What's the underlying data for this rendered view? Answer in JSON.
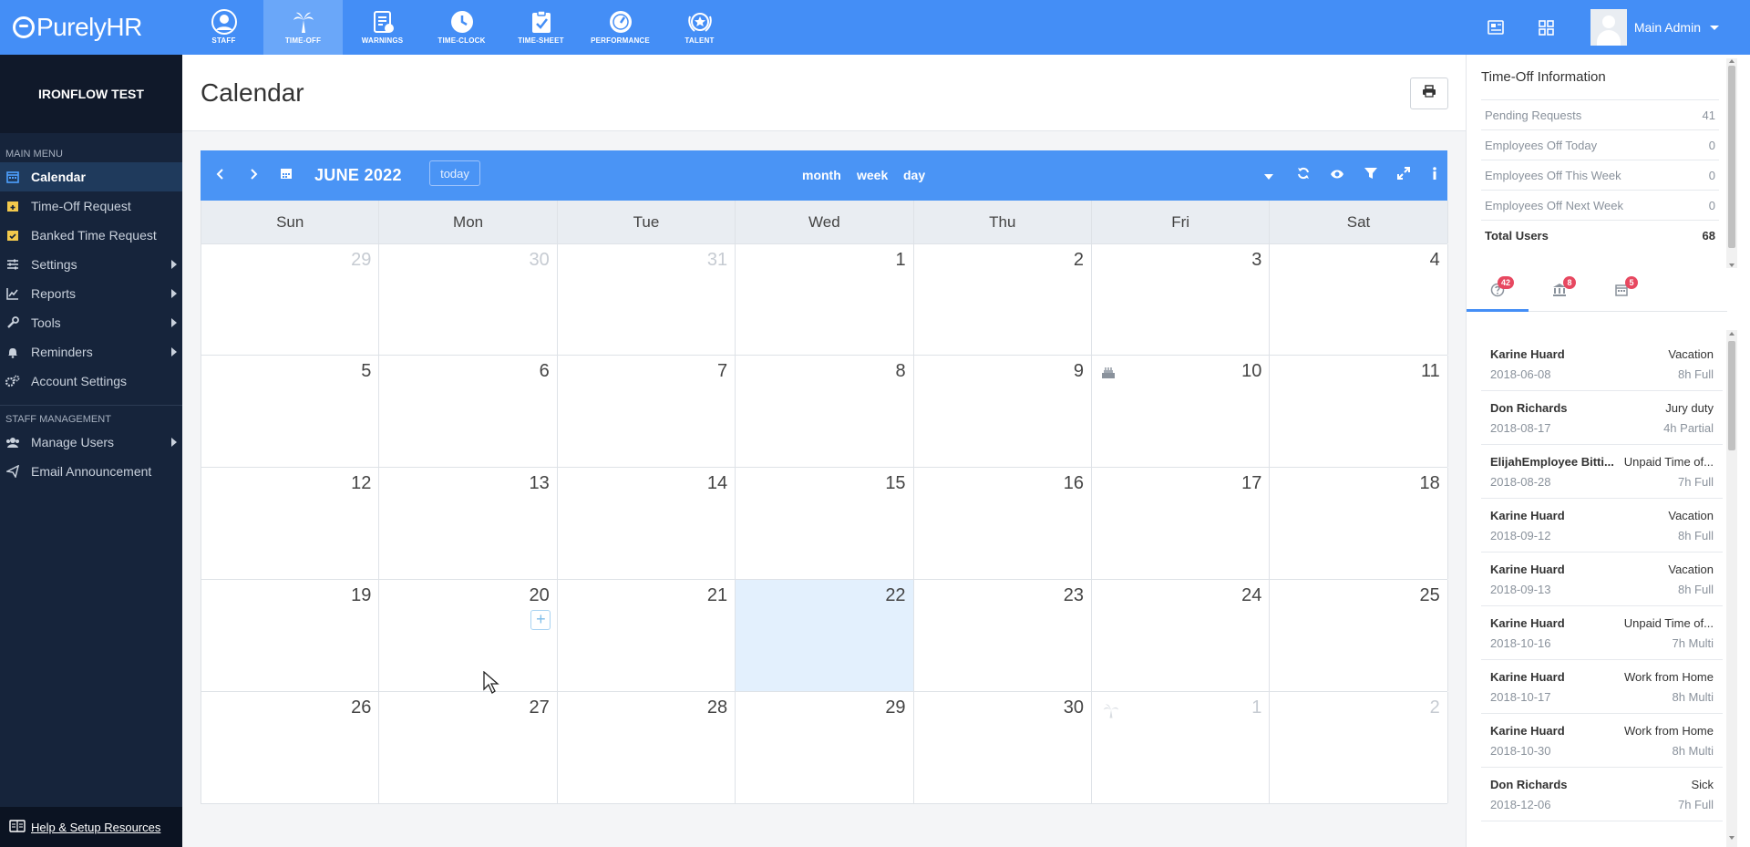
{
  "app": {
    "logo_text": "PurelyHR"
  },
  "modules": [
    {
      "label": "STAFF",
      "icon": "staff-icon"
    },
    {
      "label": "TIME-OFF",
      "icon": "palm-tree-icon",
      "active": true
    },
    {
      "label": "WARNINGS",
      "icon": "warning-doc-icon"
    },
    {
      "label": "TIME-CLOCK",
      "icon": "clock-icon"
    },
    {
      "label": "TIME-SHEET",
      "icon": "timesheet-icon"
    },
    {
      "label": "PERFORMANCE",
      "icon": "gauge-icon"
    },
    {
      "label": "TALENT",
      "icon": "award-star-icon"
    }
  ],
  "user": {
    "name": "Main Admin"
  },
  "sidebar": {
    "org_name": "IRONFLOW TEST",
    "main_menu_label": "MAIN MENU",
    "items": [
      {
        "label": "Calendar",
        "icon": "calendar-icon",
        "active": true
      },
      {
        "label": "Time-Off Request",
        "icon": "calendar-plus-icon"
      },
      {
        "label": "Banked Time Request",
        "icon": "calendar-check-icon"
      },
      {
        "label": "Settings",
        "icon": "sliders-icon",
        "submenu": true
      },
      {
        "label": "Reports",
        "icon": "chart-icon",
        "submenu": true
      },
      {
        "label": "Tools",
        "icon": "wrench-icon",
        "submenu": true
      },
      {
        "label": "Reminders",
        "icon": "bell-icon",
        "submenu": true
      },
      {
        "label": "Account Settings",
        "icon": "gears-icon"
      }
    ],
    "staff_label": "STAFF MANAGEMENT",
    "staff_items": [
      {
        "label": "Manage Users",
        "icon": "users-icon",
        "submenu": true
      },
      {
        "label": "Email Announcement",
        "icon": "paper-plane-icon"
      }
    ],
    "help_label": "Help & Setup Resources"
  },
  "page": {
    "title": "Calendar"
  },
  "calendar": {
    "title": "JUNE 2022",
    "today_label": "today",
    "views": {
      "month": "month",
      "week": "week",
      "day": "day"
    },
    "weekdays": [
      "Sun",
      "Mon",
      "Tue",
      "Wed",
      "Thu",
      "Fri",
      "Sat"
    ],
    "weeks": [
      [
        {
          "n": "29",
          "other": true
        },
        {
          "n": "30",
          "other": true
        },
        {
          "n": "31",
          "other": true
        },
        {
          "n": "1"
        },
        {
          "n": "2"
        },
        {
          "n": "3"
        },
        {
          "n": "4"
        }
      ],
      [
        {
          "n": "5"
        },
        {
          "n": "6"
        },
        {
          "n": "7"
        },
        {
          "n": "8"
        },
        {
          "n": "9"
        },
        {
          "n": "10",
          "icon": "birthday-cake-icon"
        },
        {
          "n": "11"
        }
      ],
      [
        {
          "n": "12"
        },
        {
          "n": "13"
        },
        {
          "n": "14"
        },
        {
          "n": "15"
        },
        {
          "n": "16"
        },
        {
          "n": "17"
        },
        {
          "n": "18"
        }
      ],
      [
        {
          "n": "19"
        },
        {
          "n": "20",
          "add": true
        },
        {
          "n": "21"
        },
        {
          "n": "22",
          "today": true
        },
        {
          "n": "23"
        },
        {
          "n": "24"
        },
        {
          "n": "25"
        }
      ],
      [
        {
          "n": "26"
        },
        {
          "n": "27"
        },
        {
          "n": "28"
        },
        {
          "n": "29"
        },
        {
          "n": "30"
        },
        {
          "n": "1",
          "other": true,
          "icon": "palm-tree-icon"
        },
        {
          "n": "2",
          "other": true
        }
      ]
    ]
  },
  "time_off_info": {
    "title": "Time-Off Information",
    "rows": [
      {
        "label": "Pending Requests",
        "value": "41"
      },
      {
        "label": "Employees Off Today",
        "value": "0"
      },
      {
        "label": "Employees Off This Week",
        "value": "0"
      },
      {
        "label": "Employees Off Next Week",
        "value": "0"
      },
      {
        "label": "Total Users",
        "value": "68",
        "total": true
      }
    ]
  },
  "panel_tabs": [
    {
      "icon": "question-circle-icon",
      "badge": "42",
      "active": true
    },
    {
      "icon": "bank-icon",
      "badge": "8"
    },
    {
      "icon": "calendar-small-icon",
      "badge": "5"
    }
  ],
  "requests": [
    {
      "name": "Karine Huard",
      "date": "2018-06-08",
      "type": "Vacation",
      "amount": "8h Full"
    },
    {
      "name": "Don Richards",
      "date": "2018-08-17",
      "type": "Jury duty",
      "amount": "4h Partial"
    },
    {
      "name": "ElijahEmployee Bitti...",
      "date": "2018-08-28",
      "type": "Unpaid Time of...",
      "amount": "7h Full"
    },
    {
      "name": "Karine Huard",
      "date": "2018-09-12",
      "type": "Vacation",
      "amount": "8h Full"
    },
    {
      "name": "Karine Huard",
      "date": "2018-09-13",
      "type": "Vacation",
      "amount": "8h Full"
    },
    {
      "name": "Karine Huard",
      "date": "2018-10-16",
      "type": "Unpaid Time of...",
      "amount": "7h Multi"
    },
    {
      "name": "Karine Huard",
      "date": "2018-10-17",
      "type": "Work from Home",
      "amount": "8h Multi"
    },
    {
      "name": "Karine Huard",
      "date": "2018-10-30",
      "type": "Work from Home",
      "amount": "8h Multi"
    },
    {
      "name": "Don Richards",
      "date": "2018-12-06",
      "type": "Sick",
      "amount": "7h Full"
    }
  ],
  "colors": {
    "topbar": "#448ef6",
    "sidebar": "#16243b",
    "cal_toolbar": "#4a94f5",
    "today_cell": "#e3f0fd",
    "badge": "#e74860"
  }
}
